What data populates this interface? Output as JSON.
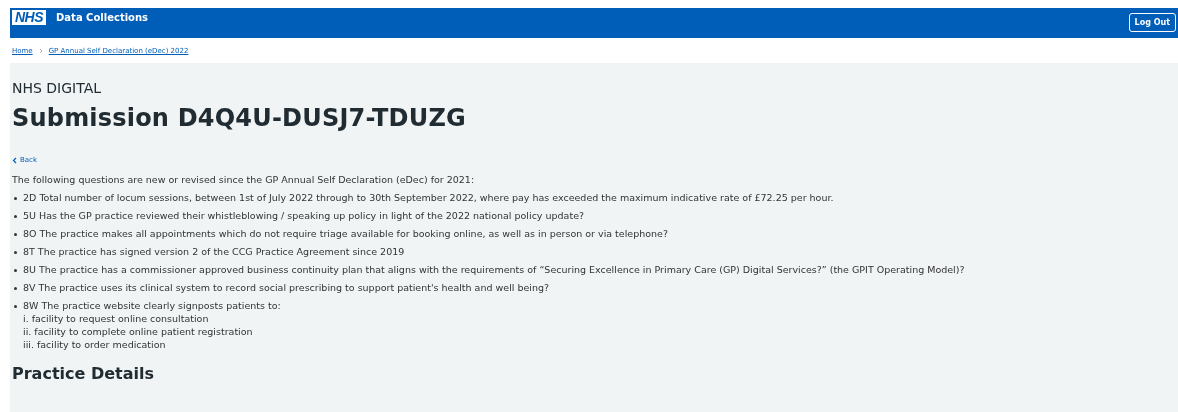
{
  "header": {
    "logo": "NHS",
    "title": "Data Collections",
    "logout": "Log Out"
  },
  "breadcrumbs": [
    {
      "label": "Home"
    },
    {
      "label": "GP Annual Self Declaration (eDec) 2022"
    }
  ],
  "org": "NHS DIGITAL",
  "title": "Submission D4Q4U-DUSJ7-TDUZG",
  "back": "Back",
  "intro": "The following questions are new or revised since the GP Annual Self Declaration (eDec) for 2021:",
  "questions": [
    {
      "text": "2D Total number of locum sessions, between 1st of July 2022 through to 30th September 2022, where pay has exceeded the maximum indicative rate of £72.25 per hour."
    },
    {
      "text": "5U Has the GP practice reviewed their whistleblowing / speaking up policy in light of the 2022 national policy update?"
    },
    {
      "text": "8O The practice makes all appointments which do not require triage available for booking online, as well as in person or via telephone?"
    },
    {
      "text": "8T The practice has signed version 2 of the CCG Practice Agreement since 2019"
    },
    {
      "text": "8U The practice has a commissioner approved business continuity plan that aligns with the requirements of “Securing Excellence in Primary Care (GP) Digital Services?” (the GPIT Operating Model)?"
    },
    {
      "text": "8V The practice uses its clinical system to record social prescribing to support patient's health and well being?"
    },
    {
      "text": "8W The practice website clearly signposts patients to:",
      "sub": [
        "i. facility to request online consultation",
        "ii. facility to complete online patient registration",
        "iii. facility to order medication"
      ]
    }
  ],
  "section_heading": "Practice Details"
}
